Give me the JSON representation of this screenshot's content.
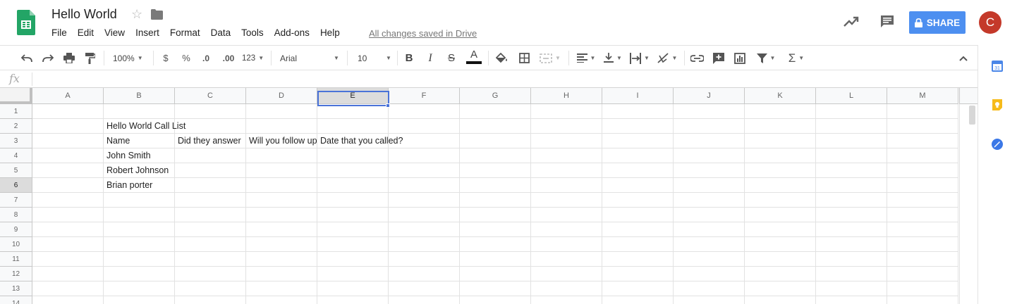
{
  "header": {
    "doc_title": "Hello World",
    "saved_status": "All changes saved in Drive",
    "share_label": "SHARE",
    "avatar_letter": "C",
    "colors": {
      "share": "#4d8ff0",
      "avatar": "#c4392a",
      "sheets_green": "#23a566"
    }
  },
  "menu": {
    "items": [
      "File",
      "Edit",
      "View",
      "Insert",
      "Format",
      "Data",
      "Tools",
      "Add-ons",
      "Help"
    ]
  },
  "toolbar": {
    "zoom": "100%",
    "currency": "$",
    "percent": "%",
    "dec_decrease": ".0",
    "dec_increase": ".00",
    "more_formats": "123",
    "font": "Arial",
    "font_size": "10",
    "bold": "B",
    "italic": "I",
    "strike": "S",
    "text_color_letter": "A",
    "sum": "Σ"
  },
  "formula_bar": {
    "fx": "fx",
    "value": ""
  },
  "sheet": {
    "columns": [
      "A",
      "B",
      "C",
      "D",
      "E",
      "F",
      "G",
      "H",
      "I",
      "J",
      "K",
      "L",
      "M"
    ],
    "selected_column": "E",
    "rows": [
      "1",
      "2",
      "3",
      "4",
      "5",
      "6",
      "7",
      "8",
      "9",
      "10",
      "11",
      "12",
      "13",
      "14"
    ],
    "selected_row": "6",
    "active_cell": "E6",
    "cells": {
      "B2": "Hello World Call List",
      "B3": "Name",
      "C3": "Did they answer",
      "D3": "Will you follow up",
      "E3": "Date that you called?",
      "B4": "John Smith",
      "B5": "Robert Johnson",
      "B6": "Brian porter"
    }
  },
  "side_panel": {
    "calendar_label": "31"
  }
}
